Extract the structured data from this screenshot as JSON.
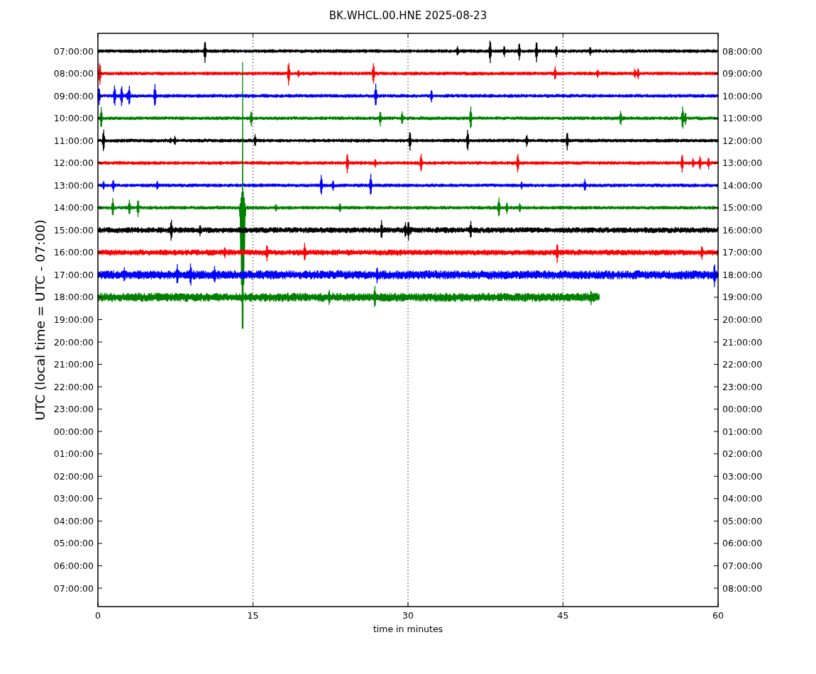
{
  "title": "BK.WHCL.00.HNE 2025-08-23",
  "ylabel": "UTC (local time = UTC - 07:00)",
  "xlabel": "time in minutes",
  "xticks": [
    "0",
    "15",
    "30",
    "45",
    "60"
  ],
  "left_labels": [
    "07:00:00",
    "08:00:00",
    "09:00:00",
    "10:00:00",
    "11:00:00",
    "12:00:00",
    "13:00:00",
    "14:00:00",
    "15:00:00",
    "16:00:00",
    "17:00:00",
    "18:00:00",
    "19:00:00",
    "20:00:00",
    "21:00:00",
    "22:00:00",
    "23:00:00",
    "00:00:00",
    "01:00:00",
    "02:00:00",
    "03:00:00",
    "04:00:00",
    "05:00:00",
    "06:00:00",
    "07:00:00"
  ],
  "right_labels": [
    "08:00:00",
    "09:00:00",
    "10:00:00",
    "11:00:00",
    "12:00:00",
    "13:00:00",
    "14:00:00",
    "15:00:00",
    "16:00:00",
    "17:00:00",
    "18:00:00",
    "19:00:00",
    "20:00:00",
    "21:00:00",
    "22:00:00",
    "23:00:00",
    "00:00:00",
    "01:00:00",
    "02:00:00",
    "03:00:00",
    "04:00:00",
    "05:00:00",
    "06:00:00",
    "07:00:00",
    "08:00:00"
  ],
  "traces": [
    {
      "color": "#000000"
    },
    {
      "color": "#ff0000"
    },
    {
      "color": "#0000ff"
    },
    {
      "color": "#008000"
    },
    {
      "color": "#000000"
    },
    {
      "color": "#ff0000"
    },
    {
      "color": "#0000ff"
    },
    {
      "color": "#008000"
    },
    {
      "color": "#000000"
    },
    {
      "color": "#ff0000"
    },
    {
      "color": "#0000ff"
    },
    {
      "color": "#008000"
    }
  ]
}
